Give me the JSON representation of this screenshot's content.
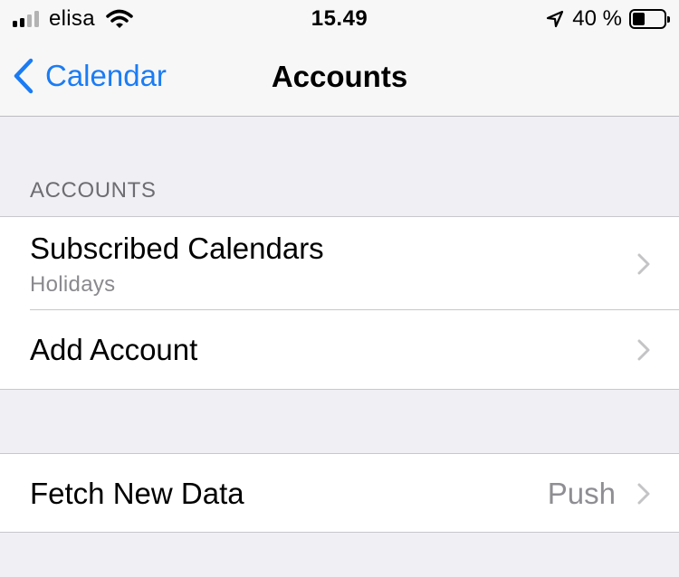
{
  "status_bar": {
    "carrier": "elisa",
    "time": "15.49",
    "battery_percent": "40 %",
    "battery_level": 0.4,
    "signal_bars_active": 2,
    "signal_bars_total": 4
  },
  "nav": {
    "back_label": "Calendar",
    "title": "Accounts"
  },
  "accounts_section": {
    "header": "ACCOUNTS",
    "rows": [
      {
        "title": "Subscribed Calendars",
        "subtitle": "Holidays"
      },
      {
        "title": "Add Account"
      }
    ]
  },
  "fetch_section": {
    "rows": [
      {
        "title": "Fetch New Data",
        "value": "Push"
      }
    ]
  },
  "colors": {
    "accent": "#1a7cf5",
    "background": "#efeff4",
    "secondary_text": "#8e8e93",
    "chevron": "#c4c4c7"
  },
  "icons": [
    "signal-icon",
    "wifi-icon",
    "location-arrow-icon",
    "battery-icon",
    "back-chevron-icon",
    "chevron-right-icon"
  ]
}
